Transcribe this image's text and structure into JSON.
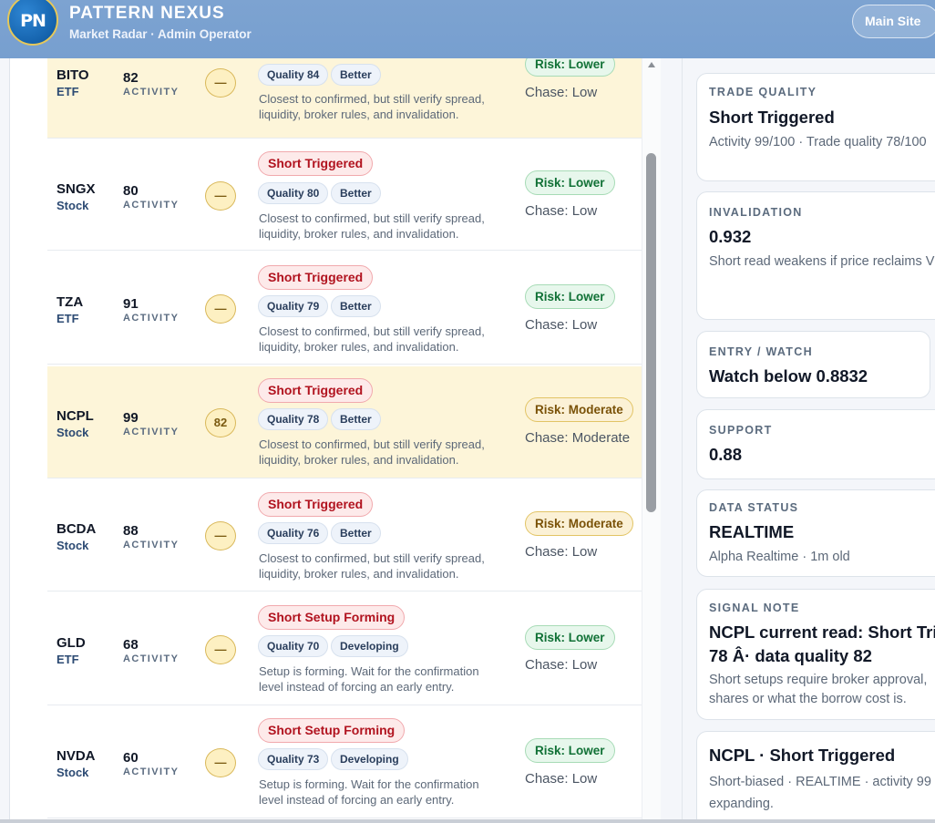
{
  "header": {
    "logo_text": "PN",
    "title": "PATTERN NEXUS",
    "subtitle": "Market Radar · Admin Operator",
    "main_site_label": "Main Site"
  },
  "rows": [
    {
      "ticker": "BITO",
      "asset": "ETF",
      "score": "82",
      "activity": "ACTIVITY",
      "circle": "—",
      "signal": "",
      "quality": "Quality 84",
      "grade": "Better",
      "desc": "Closest to confirmed, but still verify spread, liquidity, broker rules, and invalidation.",
      "risk": "Risk: Lower",
      "chase": "Chase: Low"
    },
    {
      "ticker": "SNGX",
      "asset": "Stock",
      "score": "80",
      "activity": "ACTIVITY",
      "circle": "—",
      "signal": "Short Triggered",
      "quality": "Quality 80",
      "grade": "Better",
      "desc": "Closest to confirmed, but still verify spread, liquidity, broker rules, and invalidation.",
      "risk": "Risk: Lower",
      "chase": "Chase: Low"
    },
    {
      "ticker": "TZA",
      "asset": "ETF",
      "score": "91",
      "activity": "ACTIVITY",
      "circle": "—",
      "signal": "Short Triggered",
      "quality": "Quality 79",
      "grade": "Better",
      "desc": "Closest to confirmed, but still verify spread, liquidity, broker rules, and invalidation.",
      "risk": "Risk: Lower",
      "chase": "Chase: Low"
    },
    {
      "ticker": "NCPL",
      "asset": "Stock",
      "score": "99",
      "activity": "ACTIVITY",
      "circle": "82",
      "signal": "Short Triggered",
      "quality": "Quality 78",
      "grade": "Better",
      "desc": "Closest to confirmed, but still verify spread, liquidity, broker rules, and invalidation.",
      "risk": "Risk: Moderate",
      "chase": "Chase: Moderate"
    },
    {
      "ticker": "BCDA",
      "asset": "Stock",
      "score": "88",
      "activity": "ACTIVITY",
      "circle": "—",
      "signal": "Short Triggered",
      "quality": "Quality 76",
      "grade": "Better",
      "desc": "Closest to confirmed, but still verify spread, liquidity, broker rules, and invalidation.",
      "risk": "Risk: Moderate",
      "chase": "Chase: Low"
    },
    {
      "ticker": "GLD",
      "asset": "ETF",
      "score": "68",
      "activity": "ACTIVITY",
      "circle": "—",
      "signal": "Short Setup Forming",
      "quality": "Quality 70",
      "grade": "Developing",
      "desc": "Setup is forming. Wait for the confirmation level instead of forcing an early entry.",
      "risk": "Risk: Lower",
      "chase": "Chase: Low"
    },
    {
      "ticker": "NVDA",
      "asset": "Stock",
      "score": "60",
      "activity": "ACTIVITY",
      "circle": "—",
      "signal": "Short Setup Forming",
      "quality": "Quality 73",
      "grade": "Developing",
      "desc": "Setup is forming. Wait for the confirmation level instead of forcing an early entry.",
      "risk": "Risk: Lower",
      "chase": "Chase: Low"
    }
  ],
  "detail": {
    "trade_quality": {
      "label": "TRADE QUALITY",
      "value": "Short Triggered",
      "sub": "Activity 99/100 · Trade quality 78/100"
    },
    "invalidation": {
      "label": "INVALIDATION",
      "value": "0.932",
      "sub": "Short read weakens if price reclaims V"
    },
    "entry": {
      "label": "ENTRY / WATCH",
      "value": "Watch below 0.8832"
    },
    "support": {
      "label": "SUPPORT",
      "value": "0.88"
    },
    "data_status": {
      "label": "DATA STATUS",
      "value": "REALTIME",
      "sub": "Alpha Realtime · 1m old"
    },
    "signal_note": {
      "label": "SIGNAL NOTE",
      "line1": "NCPL current read: Short Tri",
      "line2": "78 Â· data quality 82",
      "sub1": "Short setups require broker approval,",
      "sub2": "shares or what the borrow cost is."
    },
    "summary": {
      "title": "NCPL · Short Triggered",
      "sub1": "Short-biased · REALTIME · activity 99 ·",
      "sub2": "expanding."
    }
  },
  "colors": {
    "header": "#7da3d1",
    "highlight_row": "#fdf5d9",
    "signal_red": "#b1131f",
    "risk_green": "#117136",
    "risk_amber": "#7a5208"
  }
}
